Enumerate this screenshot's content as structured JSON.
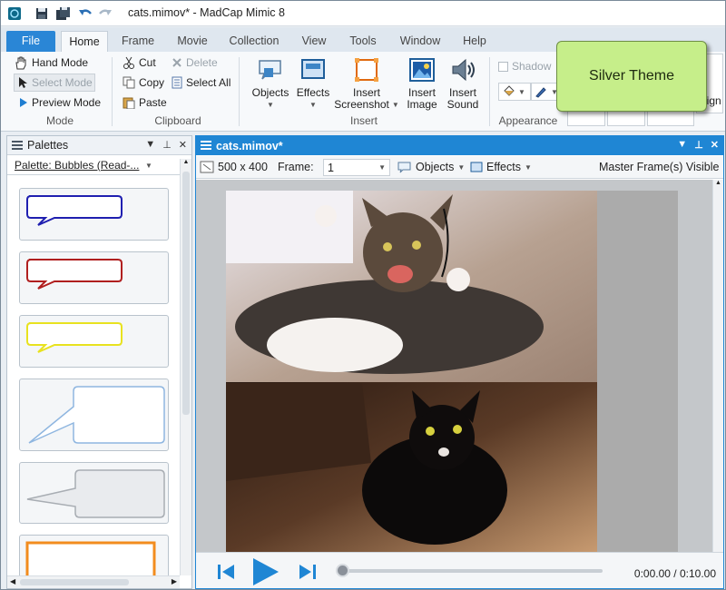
{
  "window": {
    "title": "cats.mimov* - MadCap Mimic 8"
  },
  "tabs": [
    "File",
    "Home",
    "Frame",
    "Movie",
    "Collection",
    "View",
    "Tools",
    "Window",
    "Help"
  ],
  "active_tab": "Home",
  "ribbon": {
    "mode": {
      "label": "Mode",
      "hand": "Hand Mode",
      "select": "Select Mode",
      "preview": "Preview Mode"
    },
    "clipboard": {
      "label": "Clipboard",
      "cut": "Cut",
      "copy": "Copy",
      "paste": "Paste",
      "delete": "Delete",
      "select_all": "Select All"
    },
    "insert": {
      "label": "Insert",
      "objects": "Objects",
      "effects": "Effects",
      "screenshot_line1": "Insert",
      "screenshot_line2": "Screenshot",
      "image_line1": "Insert",
      "image_line2": "Image",
      "sound_line1": "Insert",
      "sound_line2": "Sound"
    },
    "appearance": {
      "label": "Appearance",
      "shadow": "Shadow"
    },
    "partial_button": "lign"
  },
  "callout": {
    "text": "Silver Theme"
  },
  "palettes": {
    "title": "Palettes",
    "selector": "Palette: Bubbles (Read-..."
  },
  "document": {
    "tab_title": "cats.mimov*",
    "size": "500 x 400",
    "frame_label": "Frame:",
    "frame_value": "1",
    "objects": "Objects",
    "effects": "Effects",
    "master_frames": "Master Frame(s) Visible"
  },
  "player": {
    "time": "0:00.00 / 0:10.00",
    "progress": 0.0
  },
  "colors": {
    "accent": "#1f86d4",
    "file_tab": "#2a86d6",
    "callout": "#c6ee8a"
  }
}
